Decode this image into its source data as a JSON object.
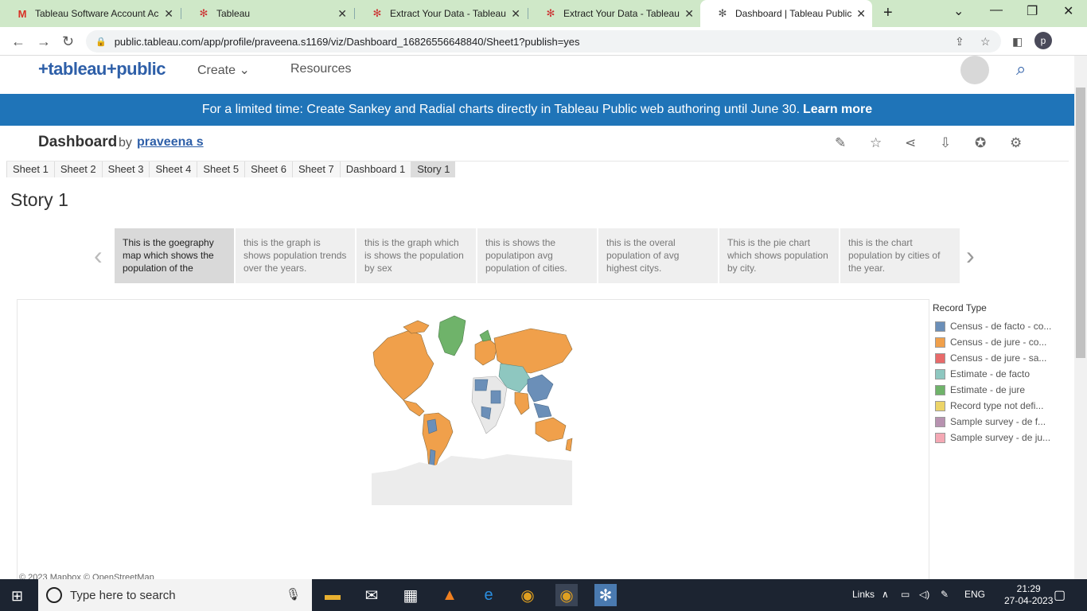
{
  "browser": {
    "tabs": [
      {
        "title": "Tableau Software Account Ac",
        "icon": "gmail-icon"
      },
      {
        "title": "Tableau",
        "icon": "tableau-icon"
      },
      {
        "title": "Extract Your Data - Tableau",
        "icon": "tableau-icon"
      },
      {
        "title": "Extract Your Data - Tableau",
        "icon": "tableau-icon"
      },
      {
        "title": "Dashboard | Tableau Public",
        "icon": "tableau-icon"
      }
    ],
    "url": "public.tableau.com/app/profile/praveena.s1169/viz/Dashboard_16826556648840/Sheet1?publish=yes",
    "profile_initial": "p"
  },
  "header": {
    "logo": "+tableau+public",
    "menu": [
      "Create",
      "Resources"
    ]
  },
  "banner": {
    "text": "For a limited time: Create Sankey and Radial charts directly in Tableau Public web authoring until June 30.",
    "link": "Learn more"
  },
  "viz": {
    "title": "Dashboard",
    "by": "by",
    "author": "praveena s"
  },
  "sheet_tabs": [
    "Sheet 1",
    "Sheet 2",
    "Sheet 3",
    "Sheet 4",
    "Sheet 5",
    "Sheet 6",
    "Sheet 7",
    "Dashboard 1",
    "Story 1"
  ],
  "story": {
    "title": "Story 1",
    "points": [
      "This is the goegraphy map which shows the population of the",
      "this is the graph is shows population trends over the years.",
      "this is the graph which is shows the population by sex",
      "this is shows the populatipon avg population of cities.",
      "this is the overal population of avg highest citys.",
      "This is the pie chart which shows population by city.",
      "this is the chart population by cities of the year."
    ]
  },
  "legend": {
    "title": "Record Type",
    "items": [
      {
        "label": "Census - de facto - co...",
        "color": "#6b8fb8"
      },
      {
        "label": "Census - de jure - co...",
        "color": "#f0a04b"
      },
      {
        "label": "Census - de jure - sa...",
        "color": "#e86a6a"
      },
      {
        "label": "Estimate - de facto",
        "color": "#8ec7c0"
      },
      {
        "label": "Estimate - de jure",
        "color": "#6fb36a"
      },
      {
        "label": "Record type not defi...",
        "color": "#ecd468"
      },
      {
        "label": "Sample survey - de f...",
        "color": "#b792b0"
      },
      {
        "label": "Sample survey - de ju...",
        "color": "#f4a8b4"
      }
    ]
  },
  "map_credit": "© 2023 Mapbox  © OpenStreetMap",
  "taskbar": {
    "search_placeholder": "Type here to search",
    "links_label": "Links",
    "lang": "ENG",
    "time": "21:29",
    "date": "27-04-2023"
  }
}
